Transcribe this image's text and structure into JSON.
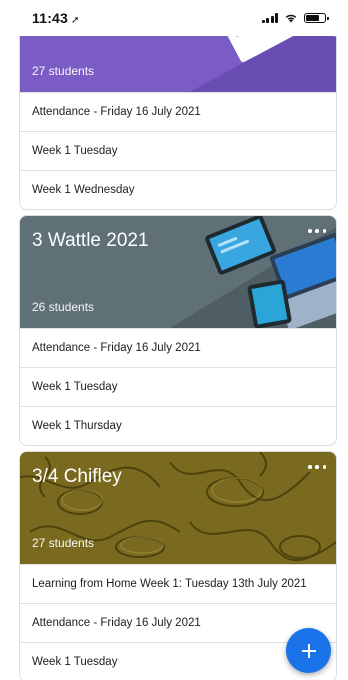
{
  "status_bar": {
    "time": "11:43",
    "location_icon": "location-arrow-icon",
    "signal_icon": "cellular-signal-icon",
    "wifi_icon": "wifi-icon",
    "battery_icon": "battery-icon"
  },
  "classes": [
    {
      "title": "",
      "students": "27 students",
      "theme_color": "#7b5cc4",
      "items": [
        "Attendance - Friday 16 July 2021",
        "Week 1 Tuesday",
        "Week 1 Wednesday"
      ]
    },
    {
      "title": "3 Wattle 2021",
      "students": "26 students",
      "theme_color": "#5f7077",
      "items": [
        "Attendance - Friday 16 July 2021",
        "Week 1 Tuesday",
        "Week 1 Thursday"
      ]
    },
    {
      "title": "3/4 Chifley",
      "students": "27 students",
      "theme_color": "#7a6a1f",
      "items": [
        "Learning from Home Week 1: Tuesday 13th July 2021",
        "Attendance - Friday 16 July 2021",
        "Week 1 Tuesday"
      ]
    }
  ],
  "fab": {
    "icon": "plus-icon"
  }
}
